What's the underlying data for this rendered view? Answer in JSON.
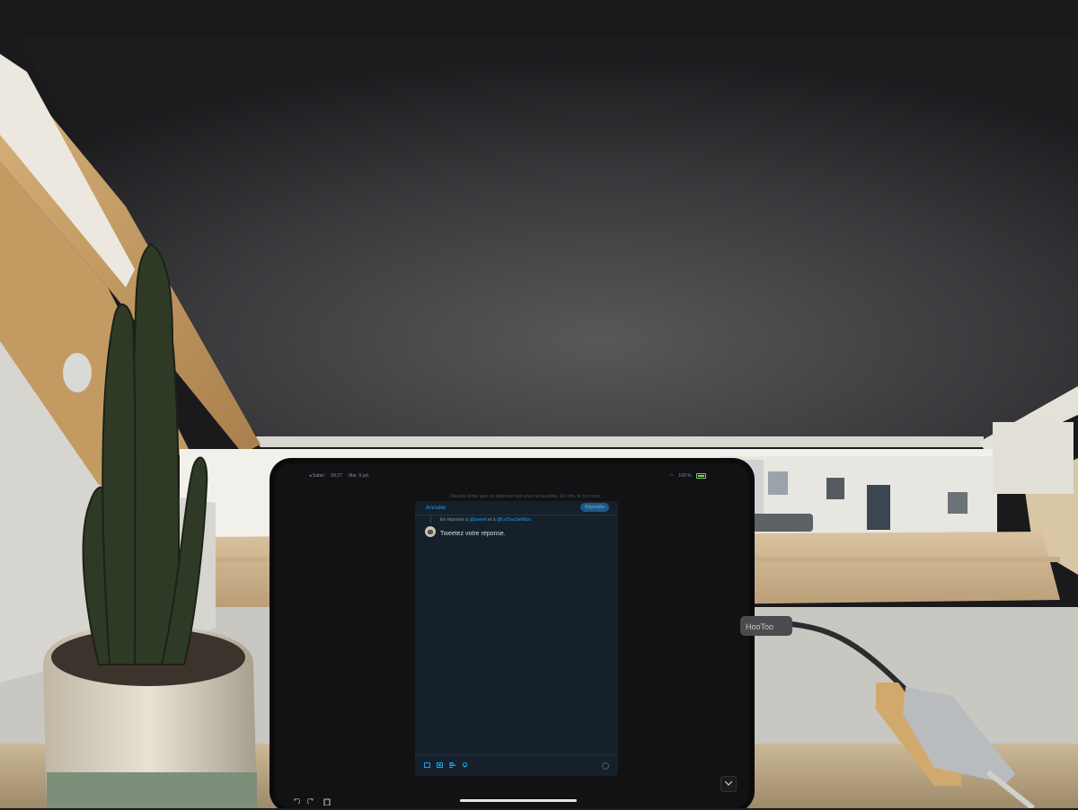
{
  "ipad": {
    "status_bar": {
      "back_app": "◂ Safari",
      "time": "09:27",
      "date": "Mar. 9 juil.",
      "battery_percent": "100 %"
    },
    "background_text": "J'aurais aimé que ce réponse soit plus accessible. Et non, le ne veux",
    "compose": {
      "cancel_label": "Annuler",
      "reply_label": "Répondre",
      "reply_context_prefix": "En réponse à",
      "reply_handle_1": "@joseet",
      "reply_context_join": "et à",
      "reply_handle_2": "@LaToucheNico",
      "input_placeholder": "Tweetez votre réponse."
    },
    "toolbar_icons": [
      "image-icon",
      "gif-icon",
      "poll-icon",
      "location-icon"
    ],
    "bottom_icons": [
      "undo-icon",
      "redo-icon",
      "paste-icon",
      "keyboard-dismiss-icon"
    ]
  },
  "scene": {
    "charger_brand": "HooToo"
  },
  "colors": {
    "twitter_blue": "#1da1f2",
    "compose_bg": "#15202b",
    "blind": "#2a2a2c",
    "wood": "#c9a673"
  }
}
